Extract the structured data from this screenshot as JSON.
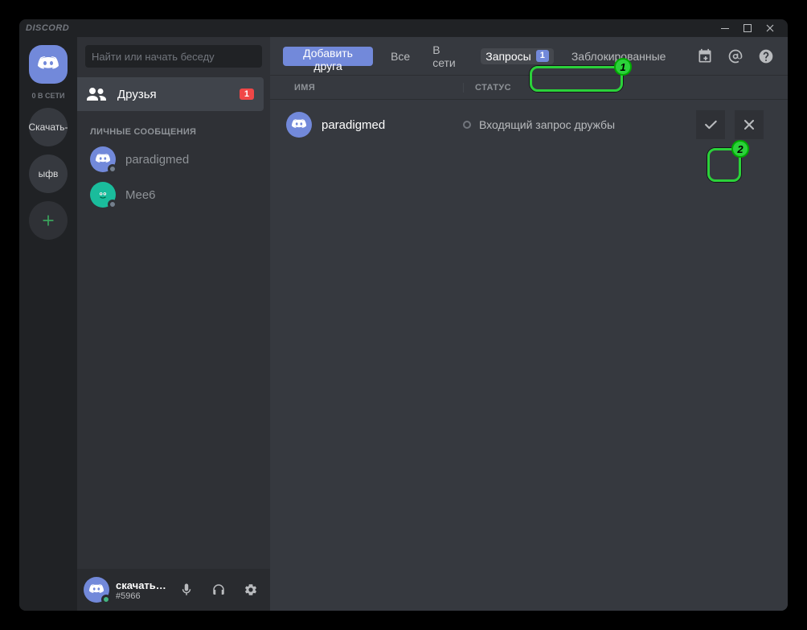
{
  "titlebar": {
    "brand": "DISCORD"
  },
  "rail": {
    "online_label": "0 В СЕТИ",
    "servers": [
      {
        "label": "Скачать-"
      },
      {
        "label": "ыфв"
      }
    ]
  },
  "sidebar": {
    "search_placeholder": "Найти или начать беседу",
    "friends_label": "Друзья",
    "friends_badge": "1",
    "dm_header": "ЛИЧНЫЕ СООБЩЕНИЯ",
    "dms": [
      {
        "name": "paradigmed"
      },
      {
        "name": "Mee6"
      }
    ]
  },
  "user": {
    "name": "скачать-дис...",
    "tag": "#5966"
  },
  "toolbar": {
    "add_friend": "Добавить друга",
    "tabs": {
      "all": "Все",
      "online": "В сети",
      "pending": "Запросы",
      "pending_badge": "1",
      "blocked": "Заблокированные"
    }
  },
  "columns": {
    "name": "ИМЯ",
    "status": "СТАТУС"
  },
  "requests": [
    {
      "name": "paradigmed",
      "status": "Входящий запрос дружбы"
    }
  ],
  "annotations": {
    "n1": "1",
    "n2": "2"
  }
}
